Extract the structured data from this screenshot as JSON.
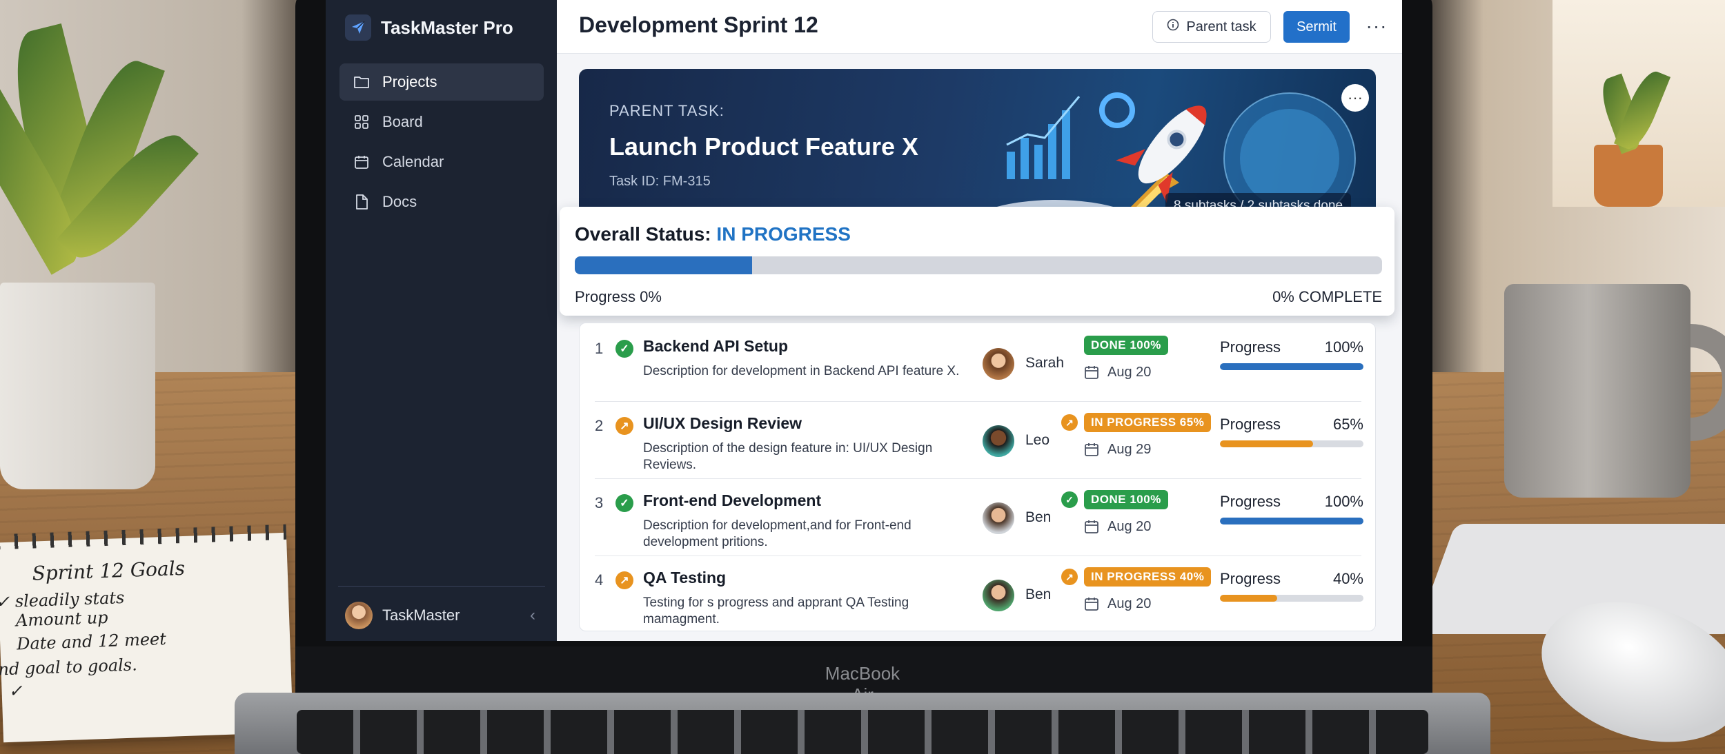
{
  "app": {
    "name": "TaskMaster Pro",
    "page_title": "Development Sprint 12"
  },
  "sidebar": {
    "items": [
      {
        "label": "Projects",
        "icon": "folder-icon",
        "active": true
      },
      {
        "label": "Board",
        "icon": "grid-icon",
        "active": false
      },
      {
        "label": "Calendar",
        "icon": "calendar-icon",
        "active": false
      },
      {
        "label": "Docs",
        "icon": "document-icon",
        "active": false
      }
    ],
    "footer": {
      "name": "TaskMaster"
    }
  },
  "toolbar": {
    "parent_task_label": "Parent task",
    "submit_label": "Sermit",
    "more_label": "···"
  },
  "banner": {
    "label": "PARENT TASK:",
    "title": "Launch Product Feature X",
    "task_id": "Task ID: FM-315",
    "subtask_summary": "8 subtasks / 2 subtasks done",
    "more_label": "···"
  },
  "status": {
    "heading": "Overall Status:",
    "value": "IN PROGRESS",
    "bar_fraction": 0.22,
    "progress_text": "Progress 0%",
    "complete_text": "0% COMPLETE"
  },
  "tasks": [
    {
      "num": "1",
      "title": "Backend API Setup",
      "desc": "Description for development in Backend API feature X.",
      "assignee": "Sarah",
      "status": "DONE 100%",
      "kind": "done",
      "date": "Aug 20",
      "progress_label": "Progress",
      "progress_text": "100%",
      "progress": 1.0
    },
    {
      "num": "2",
      "title": "UI/UX Design Review",
      "desc": "Description of the design feature in: UI/UX Design Reviews.",
      "assignee": "Leo",
      "status": "IN PROGRESS 65%",
      "kind": "progress",
      "date": "Aug 29",
      "progress_label": "Progress",
      "progress_text": "65%",
      "progress": 0.65
    },
    {
      "num": "3",
      "title": "Front-end Development",
      "desc": "Description for development,and for Front-end development pritions.",
      "assignee": "Ben",
      "status": "DONE 100%",
      "kind": "done",
      "date": "Aug 20",
      "progress_label": "Progress",
      "progress_text": "100%",
      "progress": 1.0
    },
    {
      "num": "4",
      "title": "QA Testing",
      "desc": "Testing for s progress and apprant QA Testing mamagment.",
      "assignee": "Ben",
      "status": "IN PROGRESS 40%",
      "kind": "progress",
      "date": "Aug 20",
      "progress_label": "Progress",
      "progress_text": "40%",
      "progress": 0.4
    }
  ],
  "device": {
    "label": "MacBook Air"
  },
  "notebook": {
    "lines": [
      "Sprint 12 Goals",
      "✓ sleadily stats",
      "  Amount up",
      "  Date and 12 meet",
      "nd goal to goals.",
      "  ✓"
    ]
  },
  "colors": {
    "accent": "#2270c9",
    "done": "#2a9d4b",
    "in_progress": "#e8931f",
    "sidebar_bg": "#1c2331"
  }
}
